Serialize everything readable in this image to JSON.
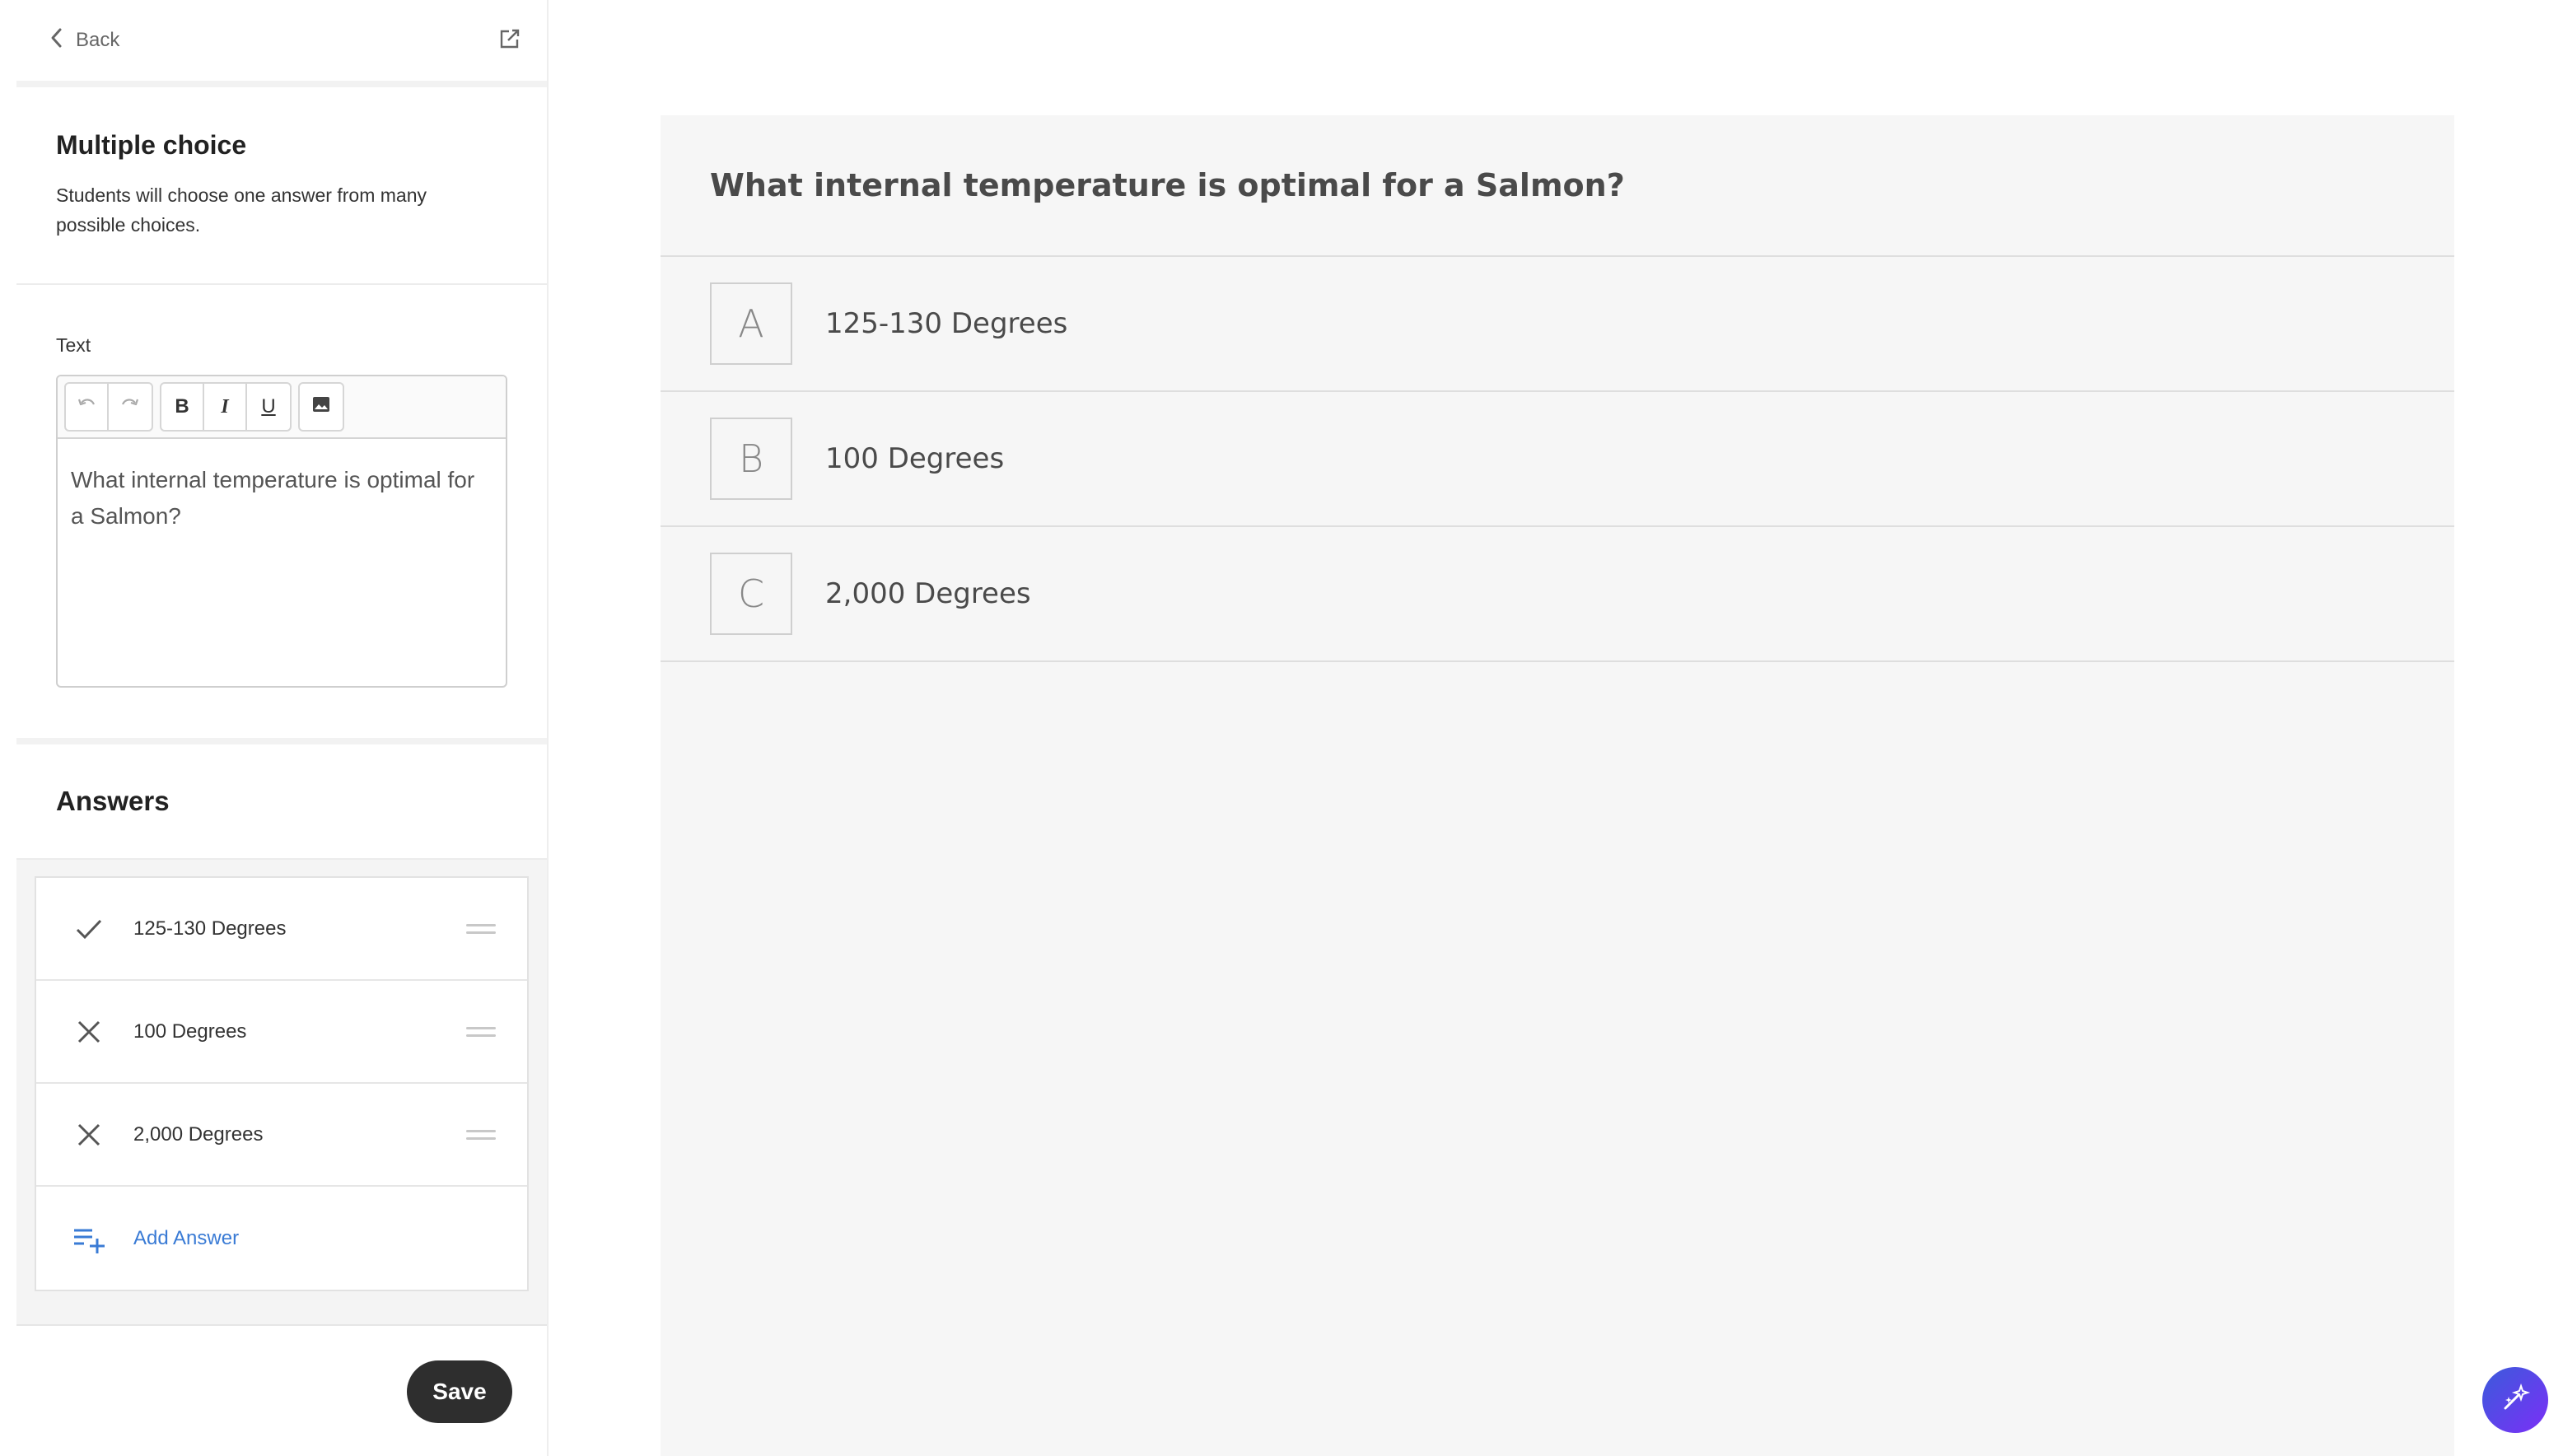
{
  "topbar": {
    "back_label": "Back"
  },
  "question_type": {
    "title": "Multiple choice",
    "description": "Students will choose one answer from many possible choices."
  },
  "text_section": {
    "label": "Text",
    "toolbar": {
      "bold": "B",
      "italic": "I",
      "underline": "U"
    },
    "content": "What internal temperature is optimal for a Salmon?"
  },
  "answers_section": {
    "title": "Answers",
    "items": [
      {
        "label": "125-130 Degrees",
        "correct": true,
        "icon": "check-icon"
      },
      {
        "label": "100 Degrees",
        "correct": false,
        "icon": "x-icon"
      },
      {
        "label": "2,000 Degrees",
        "correct": false,
        "icon": "x-icon"
      }
    ],
    "add_label": "Add Answer"
  },
  "footer": {
    "save_label": "Save"
  },
  "preview": {
    "question": "What internal temperature is optimal for a Salmon?",
    "options": [
      {
        "letter": "A",
        "text": "125-130 Degrees"
      },
      {
        "letter": "B",
        "text": "100 Degrees"
      },
      {
        "letter": "C",
        "text": "2,000 Degrees"
      }
    ]
  },
  "colors": {
    "accent_link": "#3a7bd5",
    "save_button": "#2e2e2e",
    "fab_gradient_start": "#3b5bdb",
    "fab_gradient_end": "#7b2ff7"
  }
}
